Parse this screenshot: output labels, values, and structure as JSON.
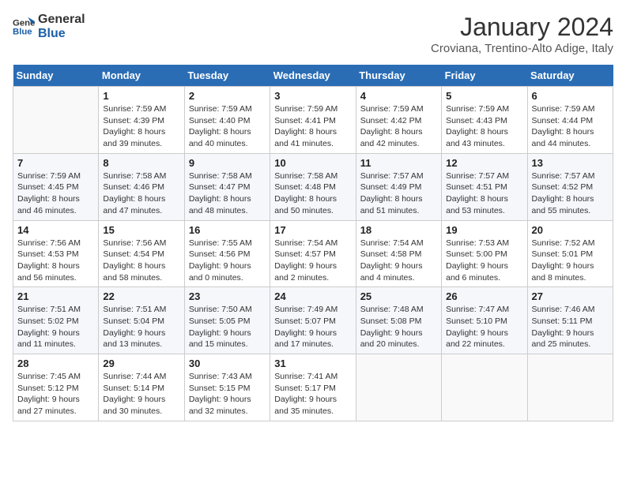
{
  "logo": {
    "line1": "General",
    "line2": "Blue"
  },
  "title": "January 2024",
  "location": "Croviana, Trentino-Alto Adige, Italy",
  "days_of_week": [
    "Sunday",
    "Monday",
    "Tuesday",
    "Wednesday",
    "Thursday",
    "Friday",
    "Saturday"
  ],
  "weeks": [
    [
      {
        "num": "",
        "sunrise": "",
        "sunset": "",
        "daylight": ""
      },
      {
        "num": "1",
        "sunrise": "Sunrise: 7:59 AM",
        "sunset": "Sunset: 4:39 PM",
        "daylight": "Daylight: 8 hours and 39 minutes."
      },
      {
        "num": "2",
        "sunrise": "Sunrise: 7:59 AM",
        "sunset": "Sunset: 4:40 PM",
        "daylight": "Daylight: 8 hours and 40 minutes."
      },
      {
        "num": "3",
        "sunrise": "Sunrise: 7:59 AM",
        "sunset": "Sunset: 4:41 PM",
        "daylight": "Daylight: 8 hours and 41 minutes."
      },
      {
        "num": "4",
        "sunrise": "Sunrise: 7:59 AM",
        "sunset": "Sunset: 4:42 PM",
        "daylight": "Daylight: 8 hours and 42 minutes."
      },
      {
        "num": "5",
        "sunrise": "Sunrise: 7:59 AM",
        "sunset": "Sunset: 4:43 PM",
        "daylight": "Daylight: 8 hours and 43 minutes."
      },
      {
        "num": "6",
        "sunrise": "Sunrise: 7:59 AM",
        "sunset": "Sunset: 4:44 PM",
        "daylight": "Daylight: 8 hours and 44 minutes."
      }
    ],
    [
      {
        "num": "7",
        "sunrise": "Sunrise: 7:59 AM",
        "sunset": "Sunset: 4:45 PM",
        "daylight": "Daylight: 8 hours and 46 minutes."
      },
      {
        "num": "8",
        "sunrise": "Sunrise: 7:58 AM",
        "sunset": "Sunset: 4:46 PM",
        "daylight": "Daylight: 8 hours and 47 minutes."
      },
      {
        "num": "9",
        "sunrise": "Sunrise: 7:58 AM",
        "sunset": "Sunset: 4:47 PM",
        "daylight": "Daylight: 8 hours and 48 minutes."
      },
      {
        "num": "10",
        "sunrise": "Sunrise: 7:58 AM",
        "sunset": "Sunset: 4:48 PM",
        "daylight": "Daylight: 8 hours and 50 minutes."
      },
      {
        "num": "11",
        "sunrise": "Sunrise: 7:57 AM",
        "sunset": "Sunset: 4:49 PM",
        "daylight": "Daylight: 8 hours and 51 minutes."
      },
      {
        "num": "12",
        "sunrise": "Sunrise: 7:57 AM",
        "sunset": "Sunset: 4:51 PM",
        "daylight": "Daylight: 8 hours and 53 minutes."
      },
      {
        "num": "13",
        "sunrise": "Sunrise: 7:57 AM",
        "sunset": "Sunset: 4:52 PM",
        "daylight": "Daylight: 8 hours and 55 minutes."
      }
    ],
    [
      {
        "num": "14",
        "sunrise": "Sunrise: 7:56 AM",
        "sunset": "Sunset: 4:53 PM",
        "daylight": "Daylight: 8 hours and 56 minutes."
      },
      {
        "num": "15",
        "sunrise": "Sunrise: 7:56 AM",
        "sunset": "Sunset: 4:54 PM",
        "daylight": "Daylight: 8 hours and 58 minutes."
      },
      {
        "num": "16",
        "sunrise": "Sunrise: 7:55 AM",
        "sunset": "Sunset: 4:56 PM",
        "daylight": "Daylight: 9 hours and 0 minutes."
      },
      {
        "num": "17",
        "sunrise": "Sunrise: 7:54 AM",
        "sunset": "Sunset: 4:57 PM",
        "daylight": "Daylight: 9 hours and 2 minutes."
      },
      {
        "num": "18",
        "sunrise": "Sunrise: 7:54 AM",
        "sunset": "Sunset: 4:58 PM",
        "daylight": "Daylight: 9 hours and 4 minutes."
      },
      {
        "num": "19",
        "sunrise": "Sunrise: 7:53 AM",
        "sunset": "Sunset: 5:00 PM",
        "daylight": "Daylight: 9 hours and 6 minutes."
      },
      {
        "num": "20",
        "sunrise": "Sunrise: 7:52 AM",
        "sunset": "Sunset: 5:01 PM",
        "daylight": "Daylight: 9 hours and 8 minutes."
      }
    ],
    [
      {
        "num": "21",
        "sunrise": "Sunrise: 7:51 AM",
        "sunset": "Sunset: 5:02 PM",
        "daylight": "Daylight: 9 hours and 11 minutes."
      },
      {
        "num": "22",
        "sunrise": "Sunrise: 7:51 AM",
        "sunset": "Sunset: 5:04 PM",
        "daylight": "Daylight: 9 hours and 13 minutes."
      },
      {
        "num": "23",
        "sunrise": "Sunrise: 7:50 AM",
        "sunset": "Sunset: 5:05 PM",
        "daylight": "Daylight: 9 hours and 15 minutes."
      },
      {
        "num": "24",
        "sunrise": "Sunrise: 7:49 AM",
        "sunset": "Sunset: 5:07 PM",
        "daylight": "Daylight: 9 hours and 17 minutes."
      },
      {
        "num": "25",
        "sunrise": "Sunrise: 7:48 AM",
        "sunset": "Sunset: 5:08 PM",
        "daylight": "Daylight: 9 hours and 20 minutes."
      },
      {
        "num": "26",
        "sunrise": "Sunrise: 7:47 AM",
        "sunset": "Sunset: 5:10 PM",
        "daylight": "Daylight: 9 hours and 22 minutes."
      },
      {
        "num": "27",
        "sunrise": "Sunrise: 7:46 AM",
        "sunset": "Sunset: 5:11 PM",
        "daylight": "Daylight: 9 hours and 25 minutes."
      }
    ],
    [
      {
        "num": "28",
        "sunrise": "Sunrise: 7:45 AM",
        "sunset": "Sunset: 5:12 PM",
        "daylight": "Daylight: 9 hours and 27 minutes."
      },
      {
        "num": "29",
        "sunrise": "Sunrise: 7:44 AM",
        "sunset": "Sunset: 5:14 PM",
        "daylight": "Daylight: 9 hours and 30 minutes."
      },
      {
        "num": "30",
        "sunrise": "Sunrise: 7:43 AM",
        "sunset": "Sunset: 5:15 PM",
        "daylight": "Daylight: 9 hours and 32 minutes."
      },
      {
        "num": "31",
        "sunrise": "Sunrise: 7:41 AM",
        "sunset": "Sunset: 5:17 PM",
        "daylight": "Daylight: 9 hours and 35 minutes."
      },
      {
        "num": "",
        "sunrise": "",
        "sunset": "",
        "daylight": ""
      },
      {
        "num": "",
        "sunrise": "",
        "sunset": "",
        "daylight": ""
      },
      {
        "num": "",
        "sunrise": "",
        "sunset": "",
        "daylight": ""
      }
    ]
  ]
}
